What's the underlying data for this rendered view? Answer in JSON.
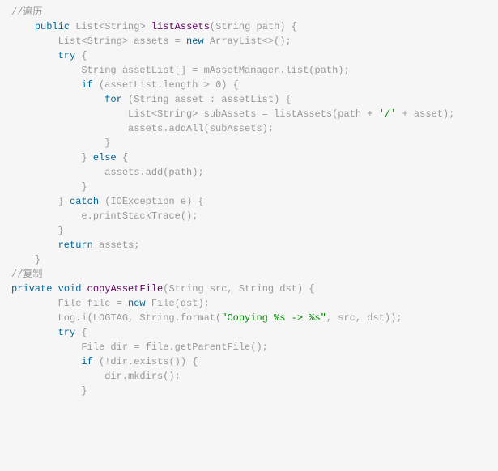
{
  "chart_data": null,
  "code": {
    "lines": [
      {
        "indent": "",
        "segments": [
          {
            "cls": "c-comment",
            "text": "//遍历"
          }
        ]
      },
      {
        "indent": "    ",
        "segments": [
          {
            "cls": "c-keyword",
            "text": "public"
          },
          {
            "cls": "",
            "text": " "
          },
          {
            "cls": "c-type",
            "text": "List<String> "
          },
          {
            "cls": "c-method",
            "text": "listAssets"
          },
          {
            "cls": "c-paren",
            "text": "("
          },
          {
            "cls": "c-type",
            "text": "String path"
          },
          {
            "cls": "c-paren",
            "text": ")"
          },
          {
            "cls": "",
            "text": " "
          },
          {
            "cls": "c-paren",
            "text": "{"
          }
        ]
      },
      {
        "indent": "        ",
        "segments": [
          {
            "cls": "c-type",
            "text": "List<String> assets = "
          },
          {
            "cls": "c-keyword",
            "text": "new"
          },
          {
            "cls": "",
            "text": " "
          },
          {
            "cls": "c-type",
            "text": "ArrayList<>();"
          }
        ]
      },
      {
        "indent": "",
        "segments": [
          {
            "cls": "",
            "text": ""
          }
        ]
      },
      {
        "indent": "        ",
        "segments": [
          {
            "cls": "c-keyword",
            "text": "try"
          },
          {
            "cls": "",
            "text": " "
          },
          {
            "cls": "c-paren",
            "text": "{"
          }
        ]
      },
      {
        "indent": "            ",
        "segments": [
          {
            "cls": "c-type",
            "text": "String assetList[] = mAssetManager.list(path);"
          }
        ]
      },
      {
        "indent": "",
        "segments": [
          {
            "cls": "",
            "text": ""
          }
        ]
      },
      {
        "indent": "            ",
        "segments": [
          {
            "cls": "c-keyword",
            "text": "if"
          },
          {
            "cls": "",
            "text": " "
          },
          {
            "cls": "c-paren",
            "text": "("
          },
          {
            "cls": "c-ident",
            "text": "assetList.length > "
          },
          {
            "cls": "c-num",
            "text": "0"
          },
          {
            "cls": "c-paren",
            "text": ")"
          },
          {
            "cls": "",
            "text": " "
          },
          {
            "cls": "c-paren",
            "text": "{"
          }
        ]
      },
      {
        "indent": "                ",
        "segments": [
          {
            "cls": "c-keyword",
            "text": "for"
          },
          {
            "cls": "",
            "text": " "
          },
          {
            "cls": "c-paren",
            "text": "("
          },
          {
            "cls": "c-type",
            "text": "String asset : assetList"
          },
          {
            "cls": "c-paren",
            "text": ")"
          },
          {
            "cls": "",
            "text": " "
          },
          {
            "cls": "c-paren",
            "text": "{"
          }
        ]
      },
      {
        "indent": "                    ",
        "segments": [
          {
            "cls": "c-type",
            "text": "List<String> subAssets = listAssets(path + "
          },
          {
            "cls": "c-char",
            "text": "'/'"
          },
          {
            "cls": "c-type",
            "text": " + asset);"
          }
        ]
      },
      {
        "indent": "                    ",
        "segments": [
          {
            "cls": "c-ident",
            "text": "assets.addAll(subAssets);"
          }
        ]
      },
      {
        "indent": "                ",
        "segments": [
          {
            "cls": "c-paren",
            "text": "}"
          }
        ]
      },
      {
        "indent": "            ",
        "segments": [
          {
            "cls": "c-paren",
            "text": "}"
          },
          {
            "cls": "",
            "text": " "
          },
          {
            "cls": "c-keyword",
            "text": "else"
          },
          {
            "cls": "",
            "text": " "
          },
          {
            "cls": "c-paren",
            "text": "{"
          }
        ]
      },
      {
        "indent": "                ",
        "segments": [
          {
            "cls": "c-ident",
            "text": "assets.add(path);"
          }
        ]
      },
      {
        "indent": "            ",
        "segments": [
          {
            "cls": "c-paren",
            "text": "}"
          }
        ]
      },
      {
        "indent": "",
        "segments": [
          {
            "cls": "",
            "text": ""
          }
        ]
      },
      {
        "indent": "        ",
        "segments": [
          {
            "cls": "c-paren",
            "text": "}"
          },
          {
            "cls": "",
            "text": " "
          },
          {
            "cls": "c-keyword",
            "text": "catch"
          },
          {
            "cls": "",
            "text": " "
          },
          {
            "cls": "c-paren",
            "text": "("
          },
          {
            "cls": "c-type",
            "text": "IOException e"
          },
          {
            "cls": "c-paren",
            "text": ")"
          },
          {
            "cls": "",
            "text": " "
          },
          {
            "cls": "c-paren",
            "text": "{"
          }
        ]
      },
      {
        "indent": "            ",
        "segments": [
          {
            "cls": "c-ident",
            "text": "e.printStackTrace();"
          }
        ]
      },
      {
        "indent": "        ",
        "segments": [
          {
            "cls": "c-paren",
            "text": "}"
          }
        ]
      },
      {
        "indent": "        ",
        "segments": [
          {
            "cls": "c-keyword",
            "text": "return"
          },
          {
            "cls": "c-ident",
            "text": " assets;"
          }
        ]
      },
      {
        "indent": "    ",
        "segments": [
          {
            "cls": "c-paren",
            "text": "}"
          }
        ]
      },
      {
        "indent": "",
        "segments": [
          {
            "cls": "c-comment",
            "text": "//复制"
          }
        ]
      },
      {
        "indent": "",
        "segments": [
          {
            "cls": "c-keyword",
            "text": "private"
          },
          {
            "cls": "",
            "text": " "
          },
          {
            "cls": "c-keyword",
            "text": "void"
          },
          {
            "cls": "",
            "text": " "
          },
          {
            "cls": "c-method",
            "text": "copyAssetFile"
          },
          {
            "cls": "c-paren",
            "text": "("
          },
          {
            "cls": "c-type",
            "text": "String src, String dst"
          },
          {
            "cls": "c-paren",
            "text": ")"
          },
          {
            "cls": "",
            "text": " "
          },
          {
            "cls": "c-paren",
            "text": "{"
          }
        ]
      },
      {
        "indent": "        ",
        "segments": [
          {
            "cls": "c-type",
            "text": "File file = "
          },
          {
            "cls": "c-keyword",
            "text": "new"
          },
          {
            "cls": "c-type",
            "text": " File(dst);"
          }
        ]
      },
      {
        "indent": "        ",
        "segments": [
          {
            "cls": "c-ident",
            "text": "Log.i(LOGTAG, String.format("
          },
          {
            "cls": "c-string",
            "text": "\"Copying %s -> %s\""
          },
          {
            "cls": "c-ident",
            "text": ", src, dst));"
          }
        ]
      },
      {
        "indent": "",
        "segments": [
          {
            "cls": "",
            "text": ""
          }
        ]
      },
      {
        "indent": "        ",
        "segments": [
          {
            "cls": "c-keyword",
            "text": "try"
          },
          {
            "cls": "",
            "text": " "
          },
          {
            "cls": "c-paren",
            "text": "{"
          }
        ]
      },
      {
        "indent": "            ",
        "segments": [
          {
            "cls": "c-type",
            "text": "File dir = file.getParentFile();"
          }
        ]
      },
      {
        "indent": "            ",
        "segments": [
          {
            "cls": "c-keyword",
            "text": "if"
          },
          {
            "cls": "",
            "text": " "
          },
          {
            "cls": "c-paren",
            "text": "("
          },
          {
            "cls": "c-ident",
            "text": "!dir.exists()"
          },
          {
            "cls": "c-paren",
            "text": ")"
          },
          {
            "cls": "",
            "text": " "
          },
          {
            "cls": "c-paren",
            "text": "{"
          }
        ]
      },
      {
        "indent": "                ",
        "segments": [
          {
            "cls": "c-ident",
            "text": "dir.mkdirs();"
          }
        ]
      },
      {
        "indent": "            ",
        "segments": [
          {
            "cls": "c-paren",
            "text": "}"
          }
        ]
      }
    ]
  }
}
